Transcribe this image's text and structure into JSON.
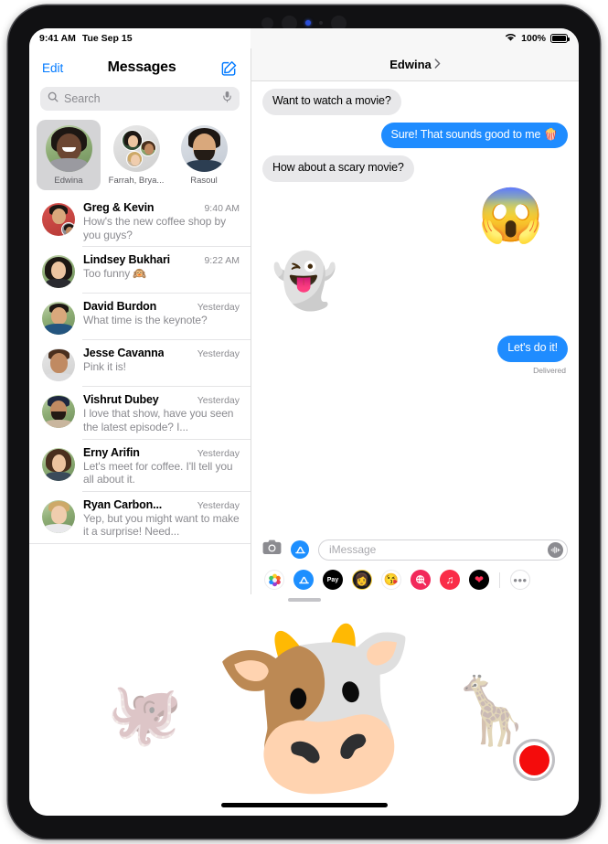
{
  "status_bar": {
    "time": "9:41 AM",
    "date": "Tue Sep 15",
    "battery_percent": "100%",
    "wifi_icon": "wifi-icon",
    "battery_icon": "battery-full-icon"
  },
  "sidebar": {
    "edit_label": "Edit",
    "title": "Messages",
    "compose_icon": "compose-icon",
    "search": {
      "placeholder": "Search",
      "value": "",
      "search_icon": "search-icon",
      "dictation_icon": "microphone-icon"
    },
    "pinned": [
      {
        "name": "Edwina",
        "selected": true
      },
      {
        "name": "Farrah, Brya...",
        "selected": false
      },
      {
        "name": "Rasoul",
        "selected": false
      }
    ],
    "conversations": [
      {
        "name": "Greg & Kevin",
        "time": "9:40 AM",
        "preview": "How's the new coffee shop by you guys?"
      },
      {
        "name": "Lindsey Bukhari",
        "time": "9:22 AM",
        "preview": "Too funny 🙉"
      },
      {
        "name": "David Burdon",
        "time": "Yesterday",
        "preview": "What time is the keynote?"
      },
      {
        "name": "Jesse Cavanna",
        "time": "Yesterday",
        "preview": "Pink it is!"
      },
      {
        "name": "Vishrut Dubey",
        "time": "Yesterday",
        "preview": "I love that show, have you seen the latest episode? I..."
      },
      {
        "name": "Erny Arifin",
        "time": "Yesterday",
        "preview": "Let's meet for coffee. I'll tell you all about it."
      },
      {
        "name": "Ryan Carbon...",
        "time": "Yesterday",
        "preview": "Yep, but you might want to make it a surprise! Need..."
      }
    ]
  },
  "conversation": {
    "title": "Edwina",
    "chevron_icon": "chevron-right-icon",
    "messages": [
      {
        "kind": "text",
        "side": "in",
        "text": "Want to watch a movie?"
      },
      {
        "kind": "text",
        "side": "out",
        "text": "Sure! That sounds good to me 🍿"
      },
      {
        "kind": "text",
        "side": "in",
        "text": "How about a scary movie?"
      },
      {
        "kind": "sticker",
        "side": "out",
        "glyph": "😱",
        "name": "memoji-shocked-sticker"
      },
      {
        "kind": "sticker",
        "side": "in",
        "glyph": "👻",
        "name": "ghost-sticker"
      },
      {
        "kind": "text",
        "side": "out",
        "text": "Let's do it!",
        "status": "Delivered"
      }
    ]
  },
  "input_bar": {
    "camera_icon": "camera-icon",
    "appstore_icon": "app-store-icon",
    "placeholder": "iMessage",
    "value": "",
    "audio_icon": "audio-waveform-icon"
  },
  "app_strip": {
    "apps": [
      {
        "name": "photos-app-icon",
        "glyph": "🌸"
      },
      {
        "name": "app-store-app-icon",
        "glyph": "A"
      },
      {
        "name": "apple-pay-app-icon",
        "glyph": "Pay"
      },
      {
        "name": "memoji-app-icon",
        "glyph": "👩"
      },
      {
        "name": "memoji-stickers-app-icon",
        "glyph": "😍"
      },
      {
        "name": "image-search-app-icon",
        "glyph": "🔍"
      },
      {
        "name": "music-app-icon",
        "glyph": "♪"
      },
      {
        "name": "digital-touch-app-icon",
        "glyph": "❤"
      }
    ],
    "more_label": "•••"
  },
  "memoji_panel": {
    "grabber": "drag-handle",
    "stickers": [
      {
        "name": "octopus-memoji",
        "glyph": "🐙"
      },
      {
        "name": "cow-memoji",
        "glyph": "🐮"
      },
      {
        "name": "giraffe-memoji",
        "glyph": "🦒"
      }
    ],
    "record_label": "record-button"
  },
  "colors": {
    "accent": "#027aff",
    "bubble_out": "#1f8cff",
    "bubble_in": "#e8e8ea",
    "record": "#f40c0c",
    "selected_pin": "#d4d4d6"
  }
}
